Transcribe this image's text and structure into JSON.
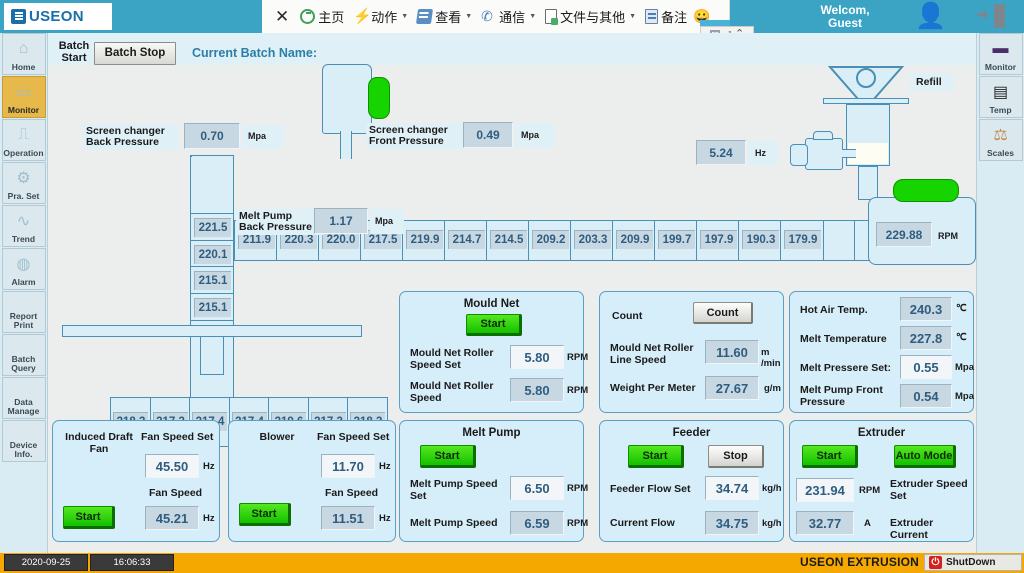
{
  "brand": {
    "name": "USEON",
    "logo_icon": "useon-logo-icon"
  },
  "ribbon": {
    "close_label": "✕",
    "menu": [
      {
        "label": "主页",
        "icon": "home-icon",
        "caret": false
      },
      {
        "label": "动作",
        "icon": "bolt-icon",
        "caret": true
      },
      {
        "label": "查看",
        "icon": "view-icon",
        "caret": true
      },
      {
        "label": "通信",
        "icon": "phone-icon",
        "caret": true
      },
      {
        "label": "文件与其他",
        "icon": "file-icon",
        "caret": true
      },
      {
        "label": "备注",
        "icon": "note-icon",
        "caret": false
      }
    ],
    "smiley": "😀",
    "window_controls": {
      "grid_icon": "grid-icon",
      "expand_icon": "expand-icon",
      "collapse_icon": "chevron-up-icon"
    },
    "welcome_line1": "Welcom,",
    "welcome_line2": "Guest",
    "avatar_icon": "user-avatar-icon",
    "logout_icon": "logout-icon"
  },
  "sidebar_left": {
    "items": [
      {
        "label": "Home",
        "icon": "home-roof-icon",
        "active": false
      },
      {
        "label": "Monitor",
        "icon": "monitor-screen-icon",
        "active": true
      },
      {
        "label": "Operation",
        "icon": "operation-icon",
        "active": false
      },
      {
        "label": "Pra. Set",
        "icon": "gear-icon",
        "active": false
      },
      {
        "label": "Trend",
        "icon": "trend-wave-icon",
        "active": false
      },
      {
        "label": "Alarm",
        "icon": "alarm-bell-icon",
        "active": false
      },
      {
        "label": "Report\nPrint",
        "icon": "report-print-icon",
        "active": false
      },
      {
        "label": "Batch\nQuery",
        "icon": "batch-query-icon",
        "active": false
      },
      {
        "label": "Data\nManage",
        "icon": "data-manage-icon",
        "active": false
      },
      {
        "label": "Device\nInfo.",
        "icon": "device-info-icon",
        "active": false
      }
    ]
  },
  "sidebar_right": {
    "items": [
      {
        "label": "Monitor",
        "icon": "monitor-screen-icon"
      },
      {
        "label": "Temp",
        "icon": "temp-chart-icon"
      },
      {
        "label": "Scales",
        "icon": "scales-icon"
      }
    ]
  },
  "batchbar": {
    "batch_start_line1": "Batch",
    "batch_start_line2": "Start",
    "batch_stop": "Batch Stop",
    "current_batch_label": "Current Batch Name:",
    "current_batch_value": ""
  },
  "schematic": {
    "screen_changer_back": {
      "label_line1": "Screen changer",
      "label_line2": "Back Pressure",
      "value": "0.70",
      "unit": "Mpa"
    },
    "screen_changer_front": {
      "label_line1": "Screen changer",
      "label_line2": "Front Pressure",
      "value": "0.49",
      "unit": "Mpa"
    },
    "melt_pump_back": {
      "label_line1": "Melt Pump",
      "label_line2": "Back Pressure",
      "value": "1.17",
      "unit": "Mpa"
    },
    "feeder_speed": {
      "value": "5.24",
      "unit": "Hz"
    },
    "refill_label": "Refill",
    "extruder_rpm": {
      "value": "229.88",
      "unit": "RPM"
    },
    "barrel_zones": [
      "211.9",
      "220.3",
      "220.0",
      "217.5",
      "219.9",
      "214.7",
      "214.5",
      "209.2",
      "203.3",
      "209.9",
      "199.7",
      "197.9",
      "190.3",
      "179.9"
    ],
    "vertical_temps": [
      "221.5",
      "220.1",
      "215.1",
      "215.1"
    ],
    "die_temps": [
      "218.3",
      "217.3",
      "217.4",
      "217.4",
      "219.6",
      "217.3",
      "218.3"
    ]
  },
  "panels": {
    "mould_net": {
      "title": "Mould Net",
      "start_button": "Start",
      "rows": [
        {
          "label_line1": "Mould Net Roller",
          "label_line2": "Speed Set",
          "value": "5.80",
          "unit": "RPM",
          "readonly": false
        },
        {
          "label_line1": "Mould Net Roller",
          "label_line2": "Speed",
          "value": "5.80",
          "unit": "RPM",
          "readonly": true
        }
      ]
    },
    "count": {
      "label": "Count",
      "button": "Count",
      "rows": [
        {
          "label_line1": "Mould Net Roller",
          "label_line2": "Line Speed",
          "value": "11.60",
          "unit": "m /min"
        },
        {
          "label_line1": "Weight Per Meter",
          "label_line2": "",
          "value": "27.67",
          "unit": "g/m"
        }
      ]
    },
    "temps": {
      "rows": [
        {
          "label_line1": "Hot Air Temp.",
          "label_line2": "",
          "value": "240.3",
          "unit": "℃",
          "readonly": true
        },
        {
          "label_line1": "Melt Temperature",
          "label_line2": "",
          "value": "227.8",
          "unit": "℃",
          "readonly": true
        },
        {
          "label_line1": "Melt Pressere Set:",
          "label_line2": "",
          "value": "0.55",
          "unit": "Mpa",
          "readonly": false
        },
        {
          "label_line1": "Melt Pump Front",
          "label_line2": "Pressure",
          "value": "0.54",
          "unit": "Mpa",
          "readonly": true
        }
      ]
    },
    "induced_draft_fan": {
      "title_line1": "Induced Draft",
      "title_line2": "Fan",
      "start_button": "Start",
      "set_label": "Fan Speed Set",
      "set_value": "45.50",
      "set_unit": "Hz",
      "actual_label": "Fan Speed",
      "actual_value": "45.21",
      "actual_unit": "Hz"
    },
    "blower": {
      "title_line1": "Blower",
      "title_line2": "",
      "start_button": "Start",
      "set_label": "Fan Speed Set",
      "set_value": "11.70",
      "set_unit": "Hz",
      "actual_label": "Fan Speed",
      "actual_value": "11.51",
      "actual_unit": "Hz"
    },
    "melt_pump": {
      "title": "Melt Pump",
      "start_button": "Start",
      "rows": [
        {
          "label_line1": "Melt Pump Speed",
          "label_line2": "Set",
          "value": "6.50",
          "unit": "RPM",
          "readonly": false
        },
        {
          "label_line1": "Melt Pump Speed",
          "label_line2": "",
          "value": "6.59",
          "unit": "RPM",
          "readonly": true
        }
      ]
    },
    "feeder": {
      "title": "Feeder",
      "start_button": "Start",
      "stop_button": "Stop",
      "rows": [
        {
          "label_line1": "Feeder Flow Set",
          "label_line2": "",
          "value": "34.74",
          "unit": "kg/h",
          "readonly": false
        },
        {
          "label_line1": "Current Flow",
          "label_line2": "",
          "value": "34.75",
          "unit": "kg/h",
          "readonly": true
        }
      ]
    },
    "extruder": {
      "title": "Extruder",
      "start_button": "Start",
      "mode_button": "Auto Mode",
      "rows": [
        {
          "value": "231.94",
          "unit": "RPM",
          "label_line1": "Extruder Speed",
          "label_line2": "Set",
          "readonly": false
        },
        {
          "value": "32.77",
          "unit": "A",
          "label_line1": "Extruder Current",
          "label_line2": "",
          "readonly": true
        }
      ]
    }
  },
  "statusbar": {
    "date": "2020-09-25",
    "time": "16:06:33",
    "brand": "USEON EXTRUSION",
    "shutdown_label": "ShutDown",
    "power_icon": "power-icon"
  },
  "colors": {
    "ribbon": "#3ba3c4",
    "accent_orange": "#e7b84a",
    "status_bar": "#f5a800",
    "green_run": "#13c000",
    "panel_bg": "#d6eef9",
    "readout_text": "#2f5d80"
  }
}
